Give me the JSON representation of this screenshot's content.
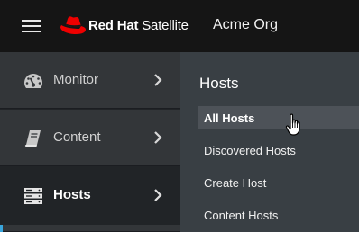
{
  "header": {
    "menu_icon": "hamburger-icon",
    "brand_logo": "red-hat-fedora-icon",
    "brand_bold": "Red Hat",
    "brand_light": " Satellite",
    "org": "Acme Org",
    "colors": {
      "brand_red": "#ee0000",
      "background": "#151515"
    }
  },
  "sidebar": {
    "items": [
      {
        "label": "Monitor",
        "icon": "dashboard-gauge-icon"
      },
      {
        "label": "Content",
        "icon": "book-icon"
      },
      {
        "label": "Hosts",
        "icon": "server-stack-icon",
        "active": true
      }
    ],
    "accent_color": "#39a5dc"
  },
  "flyout": {
    "title": "Hosts",
    "items": [
      {
        "label": "All Hosts",
        "active": true
      },
      {
        "label": "Discovered Hosts"
      },
      {
        "label": "Create Host"
      },
      {
        "label": "Content Hosts"
      }
    ]
  }
}
